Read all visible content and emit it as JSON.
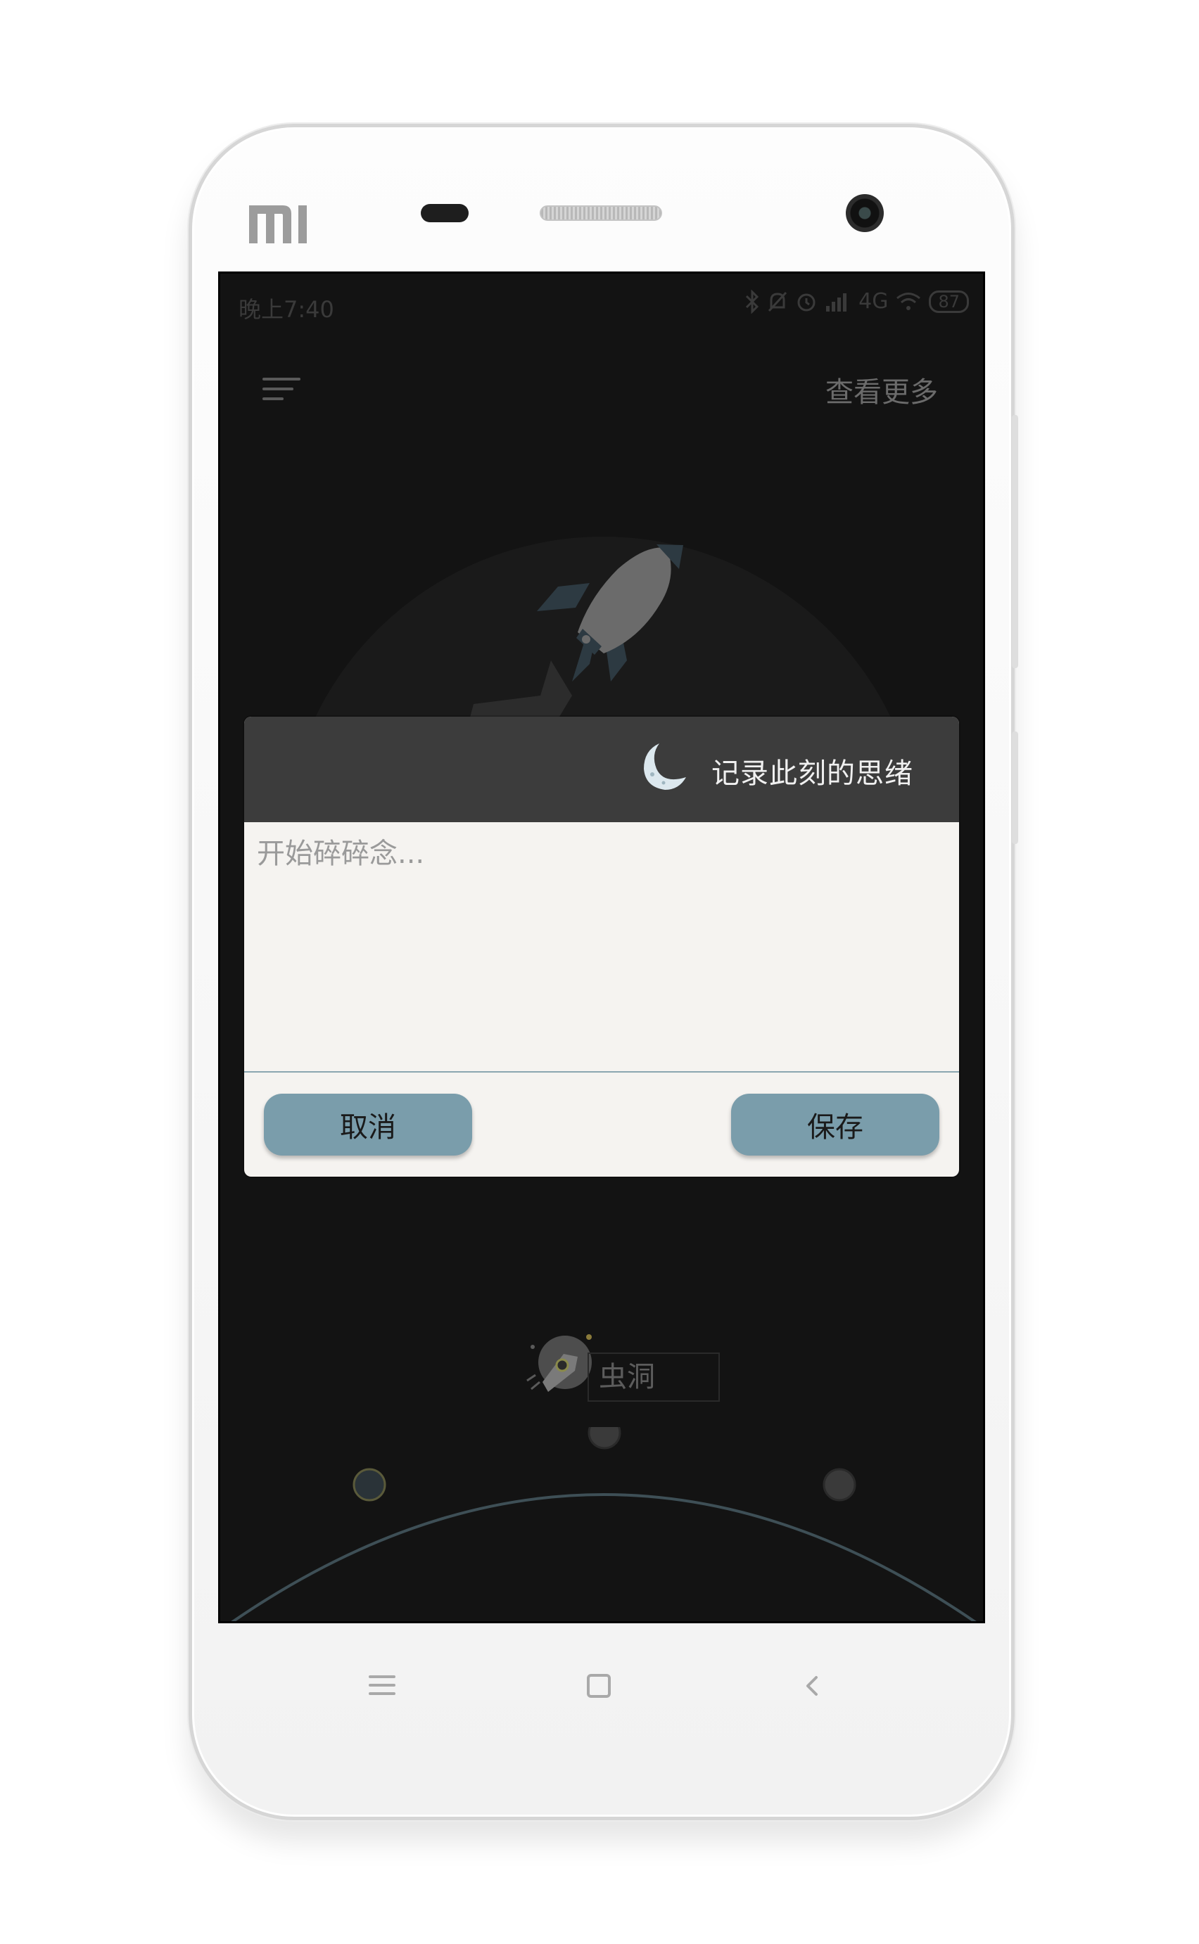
{
  "status_bar": {
    "time": "晚上7:40",
    "network": "4G",
    "battery": "87"
  },
  "header": {
    "more_link": "查看更多"
  },
  "dialog": {
    "title": "记录此刻的思绪",
    "input_placeholder": "开始碎碎念...",
    "input_value": "",
    "cancel_label": "取消",
    "save_label": "保存"
  },
  "wormhole": {
    "label": "虫洞"
  },
  "colors": {
    "screen_bg": "#131313",
    "dialog_header": "#3c3c3c",
    "dialog_body": "#f5f3f0",
    "button_bg": "#7a9dab",
    "arc_line": "#3e4f56"
  },
  "icons": [
    "mi-logo",
    "menu-icon",
    "rocket-icon",
    "moon-icon",
    "wormhole-rocket-icon",
    "bluetooth-icon",
    "mute-icon",
    "alarm-icon",
    "signal-icon",
    "wifi-icon",
    "battery-icon"
  ]
}
